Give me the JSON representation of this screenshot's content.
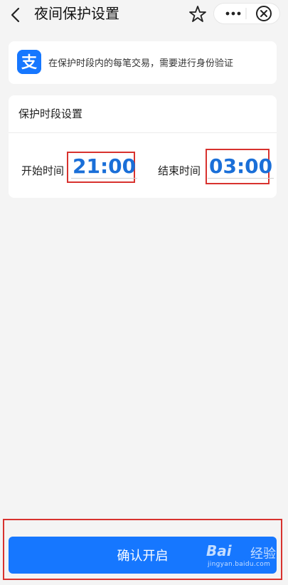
{
  "header": {
    "title": "夜间保护设置",
    "icons": [
      "chevron-left-icon",
      "star-icon",
      "more-icon",
      "close-circle-icon"
    ]
  },
  "notice": {
    "icon": "alipay-logo",
    "logo_glyph": "支",
    "text": "在保护时段内的每笔交易，需要进行身份验证"
  },
  "settings": {
    "title": "保护时段设置",
    "start_label": "开始时间",
    "start_time": "21:00",
    "end_label": "结束时间",
    "end_time": "03:00"
  },
  "footer": {
    "confirm_label": "确认开启"
  },
  "watermark": {
    "brand": "Bai",
    "brand_cn": "经验",
    "url": "jingyan.baidu.com"
  },
  "colors": {
    "primary": "#1677ff",
    "time_text": "#1a6fd8",
    "highlight_border": "#d8322e",
    "background": "#f4f4f4"
  }
}
